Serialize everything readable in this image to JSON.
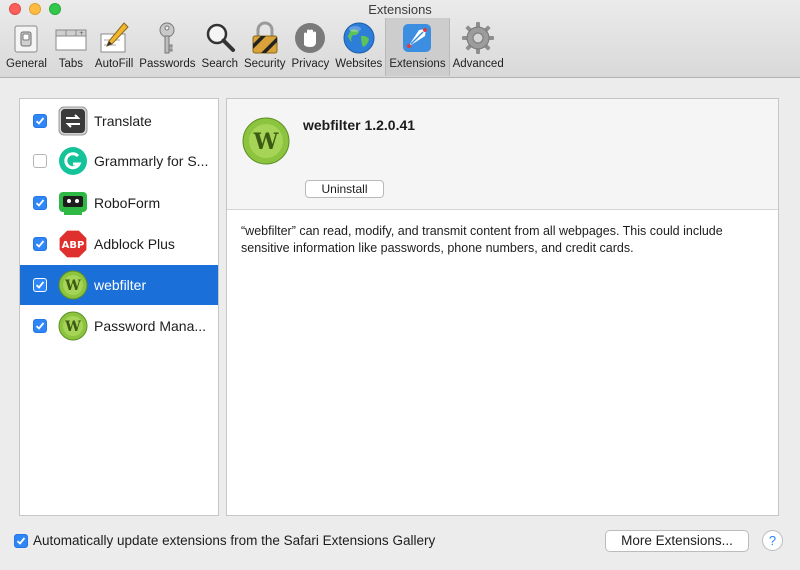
{
  "window": {
    "title": "Extensions"
  },
  "toolbar": {
    "items": [
      {
        "label": "General",
        "icon": "general-switch-icon"
      },
      {
        "label": "Tabs",
        "icon": "tabs-icon"
      },
      {
        "label": "AutoFill",
        "icon": "autofill-pencil-icon"
      },
      {
        "label": "Passwords",
        "icon": "key-icon"
      },
      {
        "label": "Search",
        "icon": "magnifier-icon"
      },
      {
        "label": "Security",
        "icon": "padlock-icon"
      },
      {
        "label": "Privacy",
        "icon": "hand-icon"
      },
      {
        "label": "Websites",
        "icon": "globe-icon"
      },
      {
        "label": "Extensions",
        "icon": "puzzle-extensions-icon",
        "active": true
      },
      {
        "label": "Advanced",
        "icon": "gear-icon"
      }
    ]
  },
  "extensions": [
    {
      "name": "Translate",
      "checked": true,
      "icon": "translate-arrows-icon"
    },
    {
      "name": "Grammarly for S...",
      "checked": false,
      "icon": "grammarly-icon"
    },
    {
      "name": "RoboForm",
      "checked": true,
      "icon": "roboform-icon"
    },
    {
      "name": "Adblock Plus",
      "checked": true,
      "icon": "abp-stop-icon",
      "badge": "ABP"
    },
    {
      "name": "webfilter",
      "checked": true,
      "icon": "webfilter-w-icon",
      "selected": true
    },
    {
      "name": "Password Mana...",
      "checked": true,
      "icon": "webfilter-w-icon"
    }
  ],
  "detail": {
    "title": "webfilter 1.2.0.41",
    "uninstall_label": "Uninstall",
    "description": "“webfilter” can read, modify, and transmit content from all webpages. This could include sensitive information like passwords, phone numbers, and credit cards."
  },
  "footer": {
    "auto_update_label": "Automatically update extensions from the Safari Extensions Gallery",
    "auto_update_checked": true,
    "more_extensions_label": "More Extensions...",
    "help_label": "?"
  },
  "colors": {
    "selection": "#1b6fd8",
    "checkbox": "#2f86f6"
  }
}
